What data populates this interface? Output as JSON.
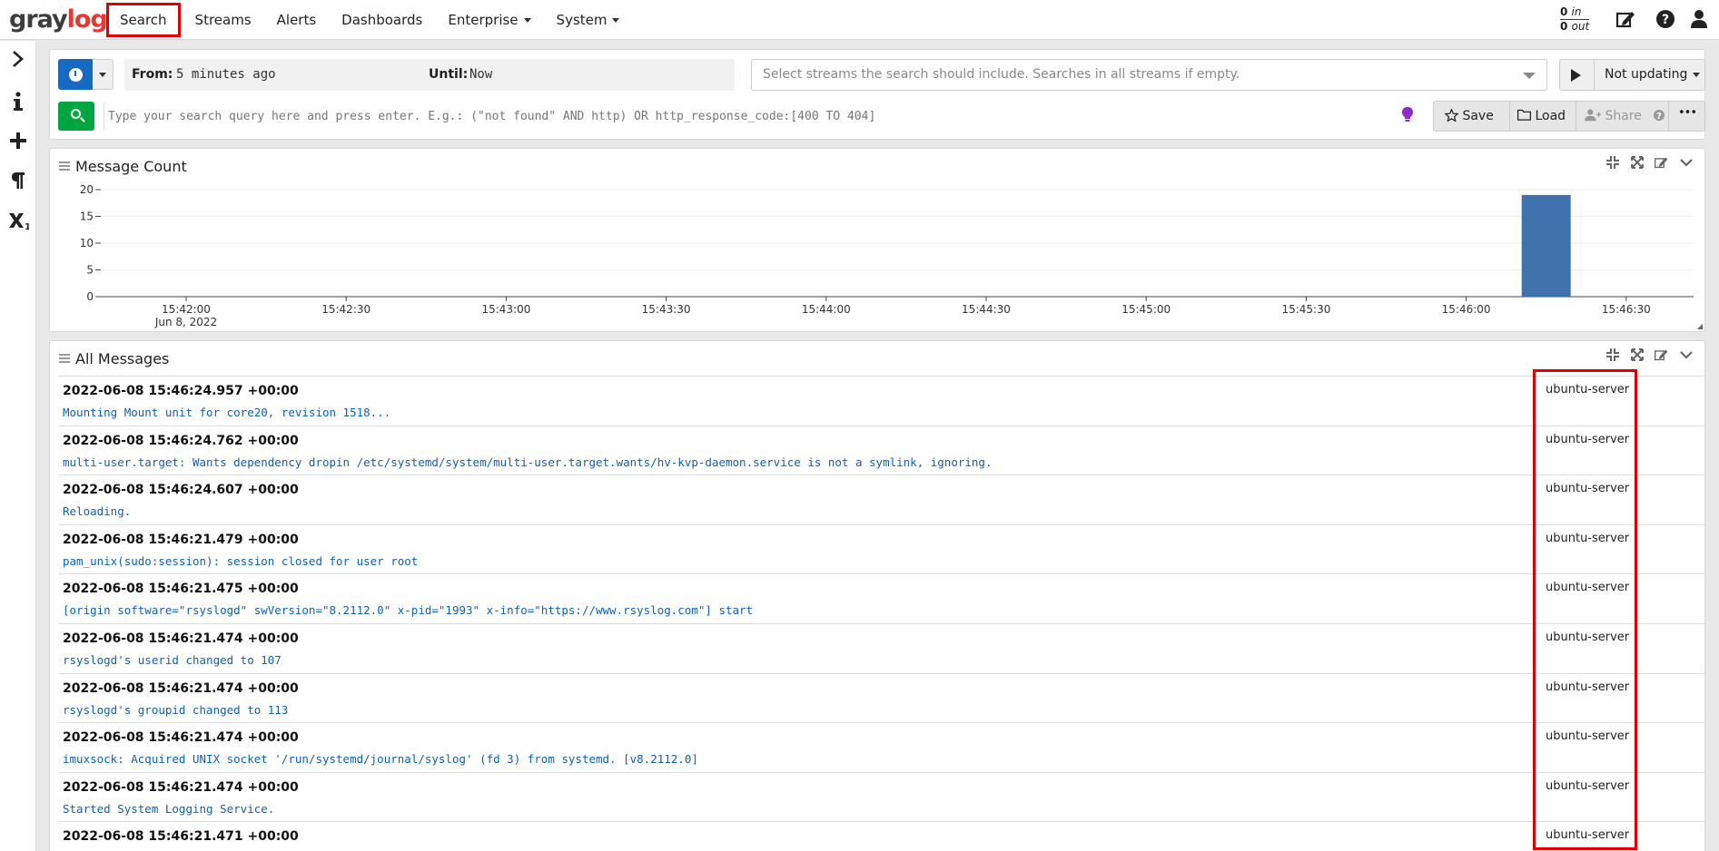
{
  "app": {
    "logo_main": "gray",
    "logo_accent": "log"
  },
  "nav": {
    "items": [
      {
        "label": "Search",
        "active": true
      },
      {
        "label": "Streams"
      },
      {
        "label": "Alerts"
      },
      {
        "label": "Dashboards"
      },
      {
        "label": "Enterprise",
        "dropdown": true
      },
      {
        "label": "System",
        "dropdown": true
      }
    ]
  },
  "throughput": {
    "in_value": "0",
    "in_unit": "in",
    "out_value": "0",
    "out_unit": "out"
  },
  "topbar_icons": [
    "edit-icon",
    "help-icon",
    "user-icon"
  ],
  "sidebar": {
    "icons": [
      "chevron-right-icon",
      "info-icon",
      "plus-icon",
      "paragraph-icon",
      "subscript-icon"
    ]
  },
  "search": {
    "from_label": "From:",
    "from_value": "5 minutes ago",
    "until_label": "Until:",
    "until_value": "Now",
    "streams_placeholder": "Select streams the search should include. Searches in all streams if empty.",
    "refresh_label": "Not updating",
    "query_placeholder": "Type your search query here and press enter. E.g.: (\"not found\" AND http) OR http_response_code:[400 TO 404]",
    "save_label": "Save",
    "load_label": "Load",
    "share_label": "Share",
    "more_label": "•••"
  },
  "message_count": {
    "title": "Message Count"
  },
  "chart_data": {
    "type": "bar",
    "title": "Message Count",
    "x_ticks": [
      "15:42:00",
      "15:42:30",
      "15:43:00",
      "15:43:30",
      "15:44:00",
      "15:44:30",
      "15:45:00",
      "15:45:30",
      "15:46:00",
      "15:46:30"
    ],
    "x_date_label": "Jun 8, 2022",
    "y_ticks": [
      0,
      5,
      10,
      15,
      20
    ],
    "ylim": [
      0,
      20
    ],
    "bars": [
      {
        "x": "15:46:15",
        "value": 19
      }
    ],
    "bar_color": "#3f72ad",
    "grid": true
  },
  "all_messages": {
    "title": "All Messages",
    "rows": [
      {
        "timestamp": "2022-06-08 15:46:24.957 +00:00",
        "message": "Mounting Mount unit for core20, revision 1518...",
        "source": "ubuntu-server"
      },
      {
        "timestamp": "2022-06-08 15:46:24.762 +00:00",
        "message": "multi-user.target: Wants dependency dropin /etc/systemd/system/multi-user.target.wants/hv-kvp-daemon.service is not a symlink, ignoring.",
        "source": "ubuntu-server"
      },
      {
        "timestamp": "2022-06-08 15:46:24.607 +00:00",
        "message": "Reloading.",
        "source": "ubuntu-server"
      },
      {
        "timestamp": "2022-06-08 15:46:21.479 +00:00",
        "message": "pam_unix(sudo:session): session closed for user root",
        "source": "ubuntu-server"
      },
      {
        "timestamp": "2022-06-08 15:46:21.475 +00:00",
        "message": "[origin software=\"rsyslogd\" swVersion=\"8.2112.0\" x-pid=\"1993\" x-info=\"https://www.rsyslog.com\"] start",
        "source": "ubuntu-server"
      },
      {
        "timestamp": "2022-06-08 15:46:21.474 +00:00",
        "message": "rsyslogd's userid changed to 107",
        "source": "ubuntu-server"
      },
      {
        "timestamp": "2022-06-08 15:46:21.474 +00:00",
        "message": "rsyslogd's groupid changed to 113",
        "source": "ubuntu-server"
      },
      {
        "timestamp": "2022-06-08 15:46:21.474 +00:00",
        "message": "imuxsock: Acquired UNIX socket '/run/systemd/journal/syslog' (fd 3) from systemd. [v8.2112.0]",
        "source": "ubuntu-server"
      },
      {
        "timestamp": "2022-06-08 15:46:21.474 +00:00",
        "message": "Started System Logging Service.",
        "source": "ubuntu-server"
      },
      {
        "timestamp": "2022-06-08 15:46:21.471 +00:00",
        "message": "",
        "source": "ubuntu-server"
      }
    ]
  },
  "colors": {
    "accent_blue": "#1769c2",
    "search_green": "#00a63f",
    "highlight_red": "#e00000",
    "message_blue": "#1060b0"
  }
}
